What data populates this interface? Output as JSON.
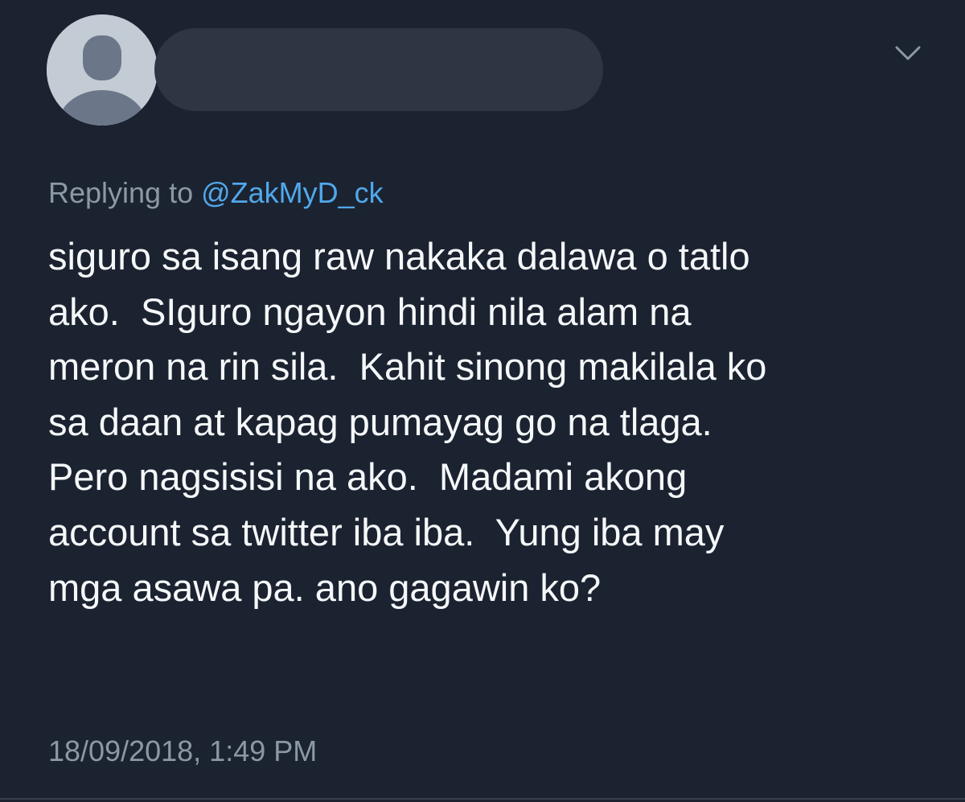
{
  "tweet": {
    "avatar_icon": "default-profile-avatar-icon",
    "menu_icon": "chevron-down-icon",
    "replying_prefix": "Replying to ",
    "replying_handle": "@ZakMyD_ck",
    "body_lines": [
      "siguro sa isang raw nakaka dalawa o tatlo",
      "ako.  SIguro ngayon hindi nila alam na",
      "meron na rin sila.  Kahit sinong makilala ko",
      "sa daan at kapag pumayag go na tlaga.",
      "Pero nagsisisi na ako.  Madami akong",
      "account sa twitter iba iba.  Yung iba may",
      "mga asawa pa. ano gagawin ko?"
    ],
    "timestamp": "18/09/2018, 1:49 PM"
  },
  "colors": {
    "background": "#1c2330",
    "primary_text": "#f5f8fa",
    "secondary_text": "#8b98a5",
    "link": "#50a8eb",
    "redaction": "#2e3543",
    "avatar_bg": "#c3cbd4",
    "avatar_fg": "#6b7789"
  }
}
